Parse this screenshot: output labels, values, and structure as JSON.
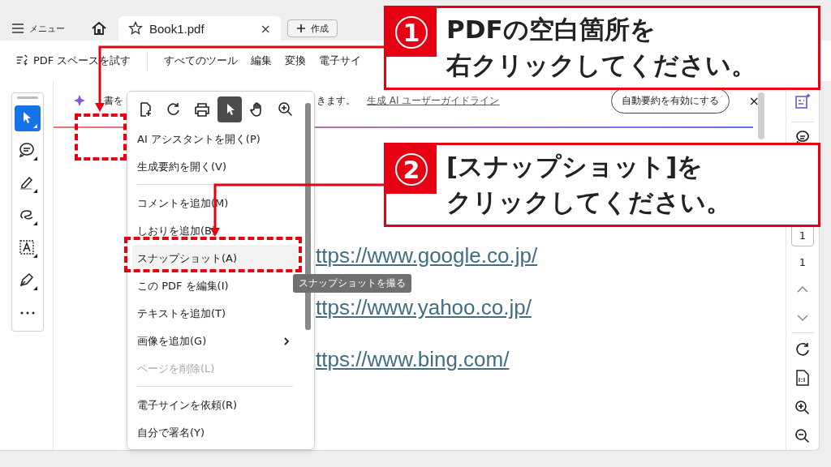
{
  "tabs_bar": {
    "menu_label": "メニュー",
    "tab": {
      "title": "Book1.pdf",
      "selected": true,
      "close": "×"
    },
    "create_label": "作成"
  },
  "toolbar": {
    "try_label": "PDF スペースを試す",
    "items": [
      "すべてのツール",
      "編集",
      "変換",
      "電子サイ"
    ]
  },
  "left_tools": [
    {
      "kind": "select",
      "selected": true
    },
    {
      "kind": "comment",
      "selected": false
    },
    {
      "kind": "highlight",
      "selected": false
    },
    {
      "kind": "draw",
      "selected": false
    },
    {
      "kind": "textbox",
      "selected": false
    },
    {
      "kind": "sign",
      "selected": false
    },
    {
      "kind": "more",
      "selected": false
    }
  ],
  "banner": {
    "text_before": "書を",
    "text_after": "きます。",
    "link": "生成 AI ユーザーガイドライン",
    "button": "自動要約を有効にする",
    "close": "×"
  },
  "document": {
    "links": [
      "ttps://www.google.co.jp/",
      "ttps://www.yahoo.co.jp/",
      "ttps://www.bing.com/"
    ]
  },
  "context_menu": {
    "tools": [
      {
        "kind": "export",
        "selected": false
      },
      {
        "kind": "rotate",
        "selected": false
      },
      {
        "kind": "print",
        "selected": false
      },
      {
        "kind": "select",
        "selected": true
      },
      {
        "kind": "hand",
        "selected": false
      },
      {
        "kind": "zoom",
        "selected": false
      }
    ],
    "groups": [
      [
        {
          "label": "AI アシスタントを開く(P)",
          "disabled": false,
          "submenu": false,
          "selected": false
        },
        {
          "label": "生成要約を開く(V)",
          "disabled": false,
          "submenu": false,
          "selected": false
        }
      ],
      [
        {
          "label": "コメントを追加(M)",
          "disabled": false,
          "submenu": false,
          "selected": false
        },
        {
          "label": "しおりを追加(B)",
          "disabled": false,
          "submenu": false,
          "selected": false
        },
        {
          "label": "スナップショット(A)",
          "disabled": false,
          "submenu": false,
          "selected": true
        },
        {
          "label": "この PDF を編集(I)",
          "disabled": false,
          "submenu": false,
          "selected": false
        },
        {
          "label": "テキストを追加(T)",
          "disabled": false,
          "submenu": false,
          "selected": false
        },
        {
          "label": "画像を追加(G)",
          "disabled": false,
          "submenu": true,
          "selected": false
        },
        {
          "label": "ページを削除(L)",
          "disabled": true,
          "submenu": false,
          "selected": false
        }
      ],
      [
        {
          "label": "電子サインを依頼(R)",
          "disabled": false,
          "submenu": false,
          "selected": false
        },
        {
          "label": "自分で署名(Y)",
          "disabled": false,
          "submenu": false,
          "selected": false
        }
      ]
    ]
  },
  "tooltip": "スナップショットを撮る",
  "right_rail": {
    "page_input": "1",
    "page_count": "1"
  },
  "callouts": [
    {
      "number": "1",
      "lines": [
        "PDFの空白箇所を",
        "右クリックしてください。"
      ]
    },
    {
      "number": "2",
      "lines": [
        "[スナップショット]を",
        "クリックしてください。"
      ]
    }
  ]
}
